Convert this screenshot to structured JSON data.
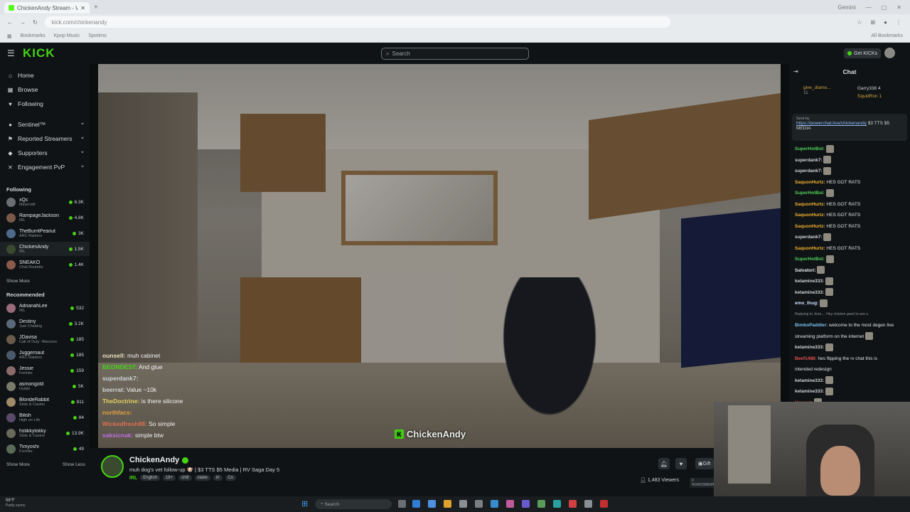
{
  "browser": {
    "tab_title": "ChickenAndy Stream - Wat...",
    "new_tab": "+",
    "gemini": "Gemini",
    "url": "kick.com/chickenandy",
    "bookmarks": [
      "Bookmarks",
      "Kpop Music",
      "Spotimo"
    ],
    "all_bookmarks": "All Bookmarks"
  },
  "header": {
    "logo": "KICK",
    "search_placeholder": "Search",
    "get_kicks": "Get KICKs"
  },
  "sidebar": {
    "nav": [
      {
        "label": "Home",
        "icon": "home-icon",
        "glyph": "⌂"
      },
      {
        "label": "Browse",
        "icon": "browse-icon",
        "glyph": "▦"
      },
      {
        "label": "Following",
        "icon": "heart-icon",
        "glyph": "♥"
      }
    ],
    "tools": [
      {
        "label": "Sentinel™",
        "icon": "sentinel-icon",
        "glyph": "●"
      },
      {
        "label": "Reported Streamers",
        "icon": "flag-icon",
        "glyph": "⚑"
      },
      {
        "label": "Supporters",
        "icon": "badge-icon",
        "glyph": "◆"
      },
      {
        "label": "Engagement PvP",
        "icon": "pvp-icon",
        "glyph": "✕"
      }
    ],
    "following_label": "Following",
    "following": [
      {
        "name": "xQc",
        "category": "Minecraft",
        "viewers": "6.3K",
        "color": "#6b6f73"
      },
      {
        "name": "RampageJackson",
        "category": "IRL",
        "viewers": "4.8K",
        "color": "#7a5a46"
      },
      {
        "name": "TheBurntPeanut",
        "category": "ARC Raiders",
        "viewers": "3K",
        "color": "#4d6a8a"
      },
      {
        "name": "ChickenAndy",
        "category": "IRL",
        "viewers": "1.5K",
        "color": "#3a4a2e"
      },
      {
        "name": "SNEAKO",
        "category": "Chat Roulette",
        "viewers": "1.4K",
        "color": "#8a5a4a"
      }
    ],
    "show_more_following": "Show More",
    "recommended_label": "Recommended",
    "recommended": [
      {
        "name": "AdrianahLee",
        "category": "IRL",
        "viewers": "532",
        "color": "#9a6a7a"
      },
      {
        "name": "Destiny",
        "category": "Just Chatting",
        "viewers": "3.2K",
        "color": "#5a6a7a"
      },
      {
        "name": "JDavisa",
        "category": "Call of Duty: Warzone",
        "viewers": "185",
        "color": "#6a5a4a"
      },
      {
        "name": "Juggernaut",
        "category": "ARC Raiders",
        "viewers": "185",
        "color": "#4a5a6a"
      },
      {
        "name": "Jessie",
        "category": "Fortnite",
        "viewers": "159",
        "color": "#8a6a6a"
      },
      {
        "name": "asmongold",
        "category": "Hytale",
        "viewers": "5K",
        "color": "#7a7a6a"
      },
      {
        "name": "BlondeRabbit",
        "category": "Slots & Casino",
        "viewers": "811",
        "color": "#a08a6a"
      },
      {
        "name": "Bilish",
        "category": "High on Life",
        "viewers": "84",
        "color": "#5a4a6a"
      },
      {
        "name": "hstikkytokky",
        "category": "Slots & Casino",
        "viewers": "13.9K",
        "color": "#6a6a5a"
      },
      {
        "name": "Timyoshi",
        "category": "Fortnite",
        "viewers": "49",
        "color": "#5a6a5a"
      }
    ],
    "show_more": "Show More",
    "show_less": "Show Less"
  },
  "video": {
    "watermark": "ChickenAndy",
    "overlay_chat": [
      {
        "user": "ounsell:",
        "text": "muh cabinet",
        "color": "#e8e0c0"
      },
      {
        "user": "BEONDEST:",
        "text": "And glue",
        "color": "#44d414"
      },
      {
        "user": "superdank7:",
        "text": "",
        "color": "#cfd3d6"
      },
      {
        "user": "beerrat:",
        "text": "Value ~10k",
        "color": "#cfd3d6"
      },
      {
        "user": "TheDoctrine:",
        "text": "is there silicone",
        "color": "#e0d060"
      },
      {
        "user": "northfacs:",
        "text": "",
        "color": "#e0a040"
      },
      {
        "user": "Wickedfresh88:",
        "text": "So simple",
        "color": "#e07050"
      },
      {
        "user": "saksicnak:",
        "text": "simple btw",
        "color": "#c070e0"
      }
    ]
  },
  "stream": {
    "name": "ChickenAndy",
    "title": "muh dog's vet follow-up 🐶 | $3 TTS $5 Media | RV Saga Day 5",
    "category": "IRL",
    "tags": [
      "English",
      "18+",
      "chill",
      "stake",
      "irl",
      "Cx"
    ],
    "viewers": "1,483 Viewers",
    "gift": "Gift",
    "sub_badge": "0 NOADSMEMBERS"
  },
  "chat": {
    "title": "Chat",
    "gifter_left_name": "give_diamo...",
    "gifter_left_count": "11",
    "gifter_right": [
      {
        "name": "Garry338",
        "count": "4"
      },
      {
        "name": "SquidRon",
        "count": "1"
      }
    ],
    "pinned_by": "Sent by",
    "pinned_link": "https://powerchat.live/chickenandy",
    "pinned_text": "$3 TTS $5 MEDIA",
    "messages": [
      {
        "user": "SuperHotBol:",
        "text": "",
        "color": "#4fd05a",
        "emote": true
      },
      {
        "user": "superdank7:",
        "text": "",
        "color": "#d0d4d7",
        "emote": true
      },
      {
        "user": "superdank7:",
        "text": "",
        "color": "#d0d4d7",
        "emote": true
      },
      {
        "user": "SaquonHurtz:",
        "text": "HES GOT RATS",
        "color": "#f0b030",
        "emote": false
      },
      {
        "user": "SuperHotBol:",
        "text": "",
        "color": "#4fd05a",
        "emote": true
      },
      {
        "user": "SaquonHurtz:",
        "text": "HES GOT RATS",
        "color": "#f0b030",
        "emote": false
      },
      {
        "user": "SaquonHurtz:",
        "text": "HES GOT RATS",
        "color": "#f0b030",
        "emote": false
      },
      {
        "user": "SaquonHurtz:",
        "text": "HES GOT RATS",
        "color": "#f0b030",
        "emote": false
      },
      {
        "user": "superdank7:",
        "text": "",
        "color": "#d0d4d7",
        "emote": true
      },
      {
        "user": "SaquonHurtz:",
        "text": "HES GOT RATS",
        "color": "#f0b030",
        "emote": false
      },
      {
        "user": "SuperHotBol:",
        "text": "",
        "color": "#4fd05a",
        "emote": true
      },
      {
        "user": "Salvatori:",
        "text": "",
        "color": "#e8e8e8",
        "emote": true
      },
      {
        "user": "ketamine333:",
        "text": "",
        "color": "#d0d4d7",
        "emote": true
      },
      {
        "user": "ketamine333:",
        "text": "",
        "color": "#d0d4d7",
        "emote": true
      },
      {
        "user": "emo_thug:",
        "text": "",
        "color": "#cfe0ff",
        "emote": true
      }
    ],
    "reply_note": "Replying to Jenn...: Hey chicken good to see u",
    "messages2": [
      {
        "user": "BimboPaddler:",
        "text": "welcome to the most degen live",
        "color": "#7ac0f0",
        "emote": false
      },
      {
        "user": "",
        "text": "streaming platform on the internet",
        "color": "#e3e6e8",
        "emote": true
      },
      {
        "user": "ketamine333:",
        "text": "",
        "color": "#d0d4d7",
        "emote": true
      },
      {
        "user": "Beef1488:",
        "text": "hes flipping the rv chat this is",
        "color": "#e05050",
        "emote": false
      },
      {
        "user": "",
        "text": "intended redesign",
        "color": "#e3e6e8",
        "emote": false
      },
      {
        "user": "ketamine333:",
        "text": "",
        "color": "#d0d4d7",
        "emote": true
      },
      {
        "user": "ketamine333:",
        "text": "",
        "color": "#d0d4d7",
        "emote": true
      },
      {
        "user": "Heavy.t:",
        "text": "",
        "color": "#e05050",
        "emote": true
      },
      {
        "user": "Heavy.t:",
        "text": "",
        "color": "#e05050",
        "emote": true
      }
    ]
  },
  "taskbar": {
    "temp": "58°F",
    "weather": "Partly sunny",
    "search": "Search"
  }
}
